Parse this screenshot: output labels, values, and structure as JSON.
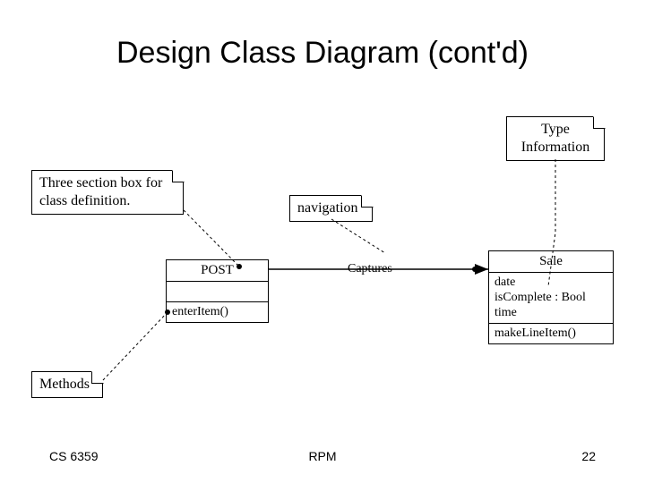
{
  "title": "Design Class Diagram (cont'd)",
  "notes": {
    "type_info": "Type\nInformation",
    "three_section": "Three section box for\nclass definition.",
    "navigation": "navigation",
    "methods": "Methods"
  },
  "classes": {
    "post": {
      "name": "POST",
      "method": "enterItem()"
    },
    "sale": {
      "name": "Sale",
      "attr1": "date",
      "attr2": "isComplete : Bool",
      "attr3": "time",
      "method": "makeLineItem()"
    }
  },
  "association": {
    "label": "Captures"
  },
  "footer": {
    "left": "CS 6359",
    "center": "RPM",
    "right": "22"
  }
}
